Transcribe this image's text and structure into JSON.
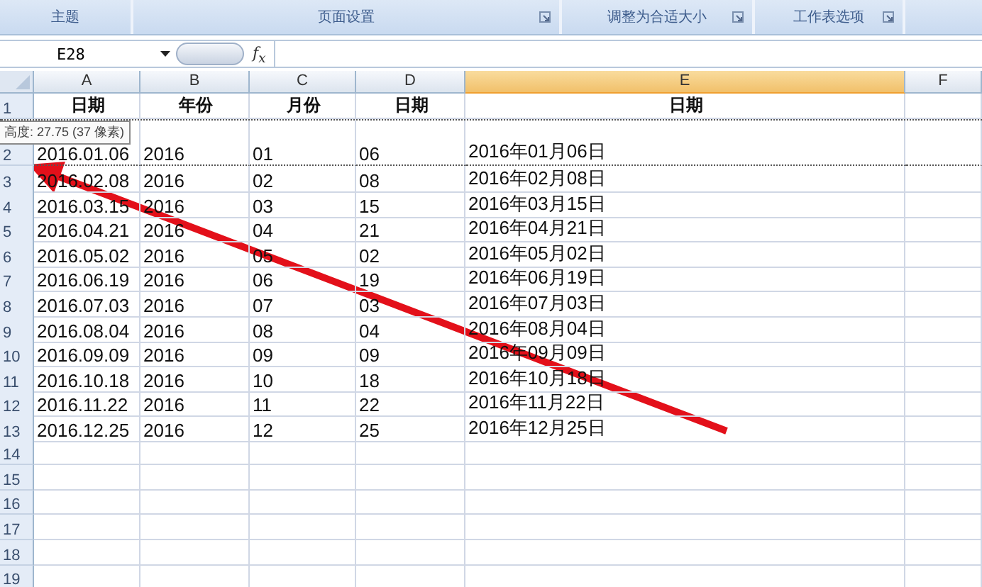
{
  "ribbon": {
    "groups": [
      {
        "label": "主题",
        "launcher": false
      },
      {
        "label": "页面设置",
        "launcher": true
      },
      {
        "label": "调整为合适大小",
        "launcher": true
      },
      {
        "label": "工作表选项",
        "launcher": true
      }
    ]
  },
  "formula_bar": {
    "name_box": "E28",
    "fx_label": "f$_{x}$"
  },
  "columns": [
    {
      "label": "A",
      "selected": false
    },
    {
      "label": "B",
      "selected": false
    },
    {
      "label": "C",
      "selected": false
    },
    {
      "label": "D",
      "selected": false
    },
    {
      "label": "E",
      "selected": true
    },
    {
      "label": "F",
      "selected": false
    }
  ],
  "height_tooltip": "高度: 27.75 (37 像素)",
  "rows": [
    {
      "number": "1",
      "kind": "header",
      "resizing": false,
      "cells": [
        "日期",
        "年份",
        "月份",
        "日期",
        "日期"
      ]
    },
    {
      "number": "2",
      "kind": "data",
      "resizing": true,
      "cells": [
        "2016.01.06",
        "2016",
        "01",
        "06",
        "2016年01月06日"
      ]
    },
    {
      "number": "3",
      "kind": "data",
      "resizing": false,
      "cells": [
        "2016.02.08",
        "2016",
        "02",
        "08",
        "2016年02月08日"
      ]
    },
    {
      "number": "4",
      "kind": "data",
      "resizing": false,
      "cells": [
        "2016.03.15",
        "2016",
        "03",
        "15",
        "2016年03月15日"
      ]
    },
    {
      "number": "5",
      "kind": "data",
      "resizing": false,
      "cells": [
        "2016.04.21",
        "2016",
        "04",
        "21",
        "2016年04月21日"
      ]
    },
    {
      "number": "6",
      "kind": "data",
      "resizing": false,
      "cells": [
        "2016.05.02",
        "2016",
        "05",
        "02",
        "2016年05月02日"
      ]
    },
    {
      "number": "7",
      "kind": "data",
      "resizing": false,
      "cells": [
        "2016.06.19",
        "2016",
        "06",
        "19",
        "2016年06月19日"
      ]
    },
    {
      "number": "8",
      "kind": "data",
      "resizing": false,
      "cells": [
        "2016.07.03",
        "2016",
        "07",
        "03",
        "2016年07月03日"
      ]
    },
    {
      "number": "9",
      "kind": "data",
      "resizing": false,
      "cells": [
        "2016.08.04",
        "2016",
        "08",
        "04",
        "2016年08月04日"
      ]
    },
    {
      "number": "10",
      "kind": "data",
      "resizing": false,
      "cells": [
        "2016.09.09",
        "2016",
        "09",
        "09",
        "2016年09月09日"
      ]
    },
    {
      "number": "11",
      "kind": "data",
      "resizing": false,
      "cells": [
        "2016.10.18",
        "2016",
        "10",
        "18",
        "2016年10月18日"
      ]
    },
    {
      "number": "12",
      "kind": "data",
      "resizing": false,
      "cells": [
        "2016.11.22",
        "2016",
        "11",
        "22",
        "2016年11月22日"
      ]
    },
    {
      "number": "13",
      "kind": "data",
      "resizing": false,
      "cells": [
        "2016.12.25",
        "2016",
        "12",
        "25",
        "2016年12月25日"
      ]
    },
    {
      "number": "14",
      "kind": "data",
      "resizing": false
    },
    {
      "number": "15",
      "kind": "data",
      "resizing": false
    },
    {
      "number": "16",
      "kind": "data",
      "resizing": false
    },
    {
      "number": "17",
      "kind": "data",
      "resizing": false
    },
    {
      "number": "18",
      "kind": "data",
      "resizing": false
    },
    {
      "number": "19",
      "kind": "data",
      "resizing": false
    }
  ]
}
